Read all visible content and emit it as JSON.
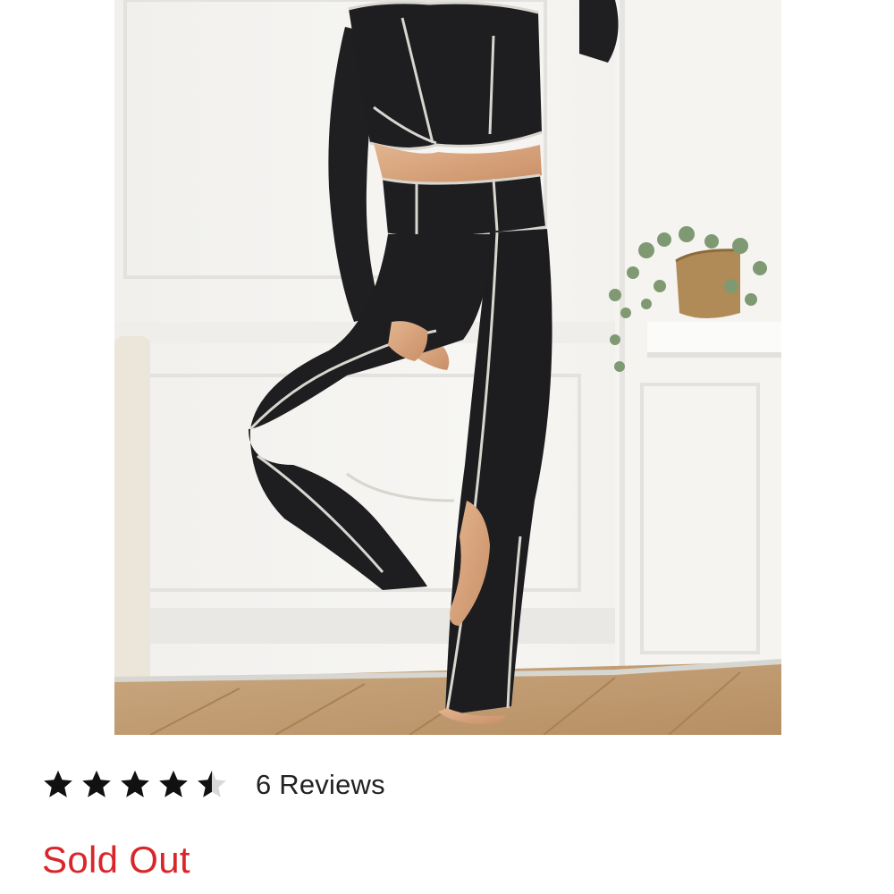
{
  "product": {
    "image_alt": "Black ribbed crop top and flare pants with contrast stitching",
    "rating": {
      "value": 4.5,
      "max": 5,
      "reviews_label": "6 Reviews"
    },
    "status": "Sold Out"
  },
  "colors": {
    "status_red": "#d9262b",
    "star": "#111111",
    "star_empty": "#d8d8d8"
  },
  "icons": {
    "star_full": "star-icon",
    "star_half": "star-half-icon"
  }
}
